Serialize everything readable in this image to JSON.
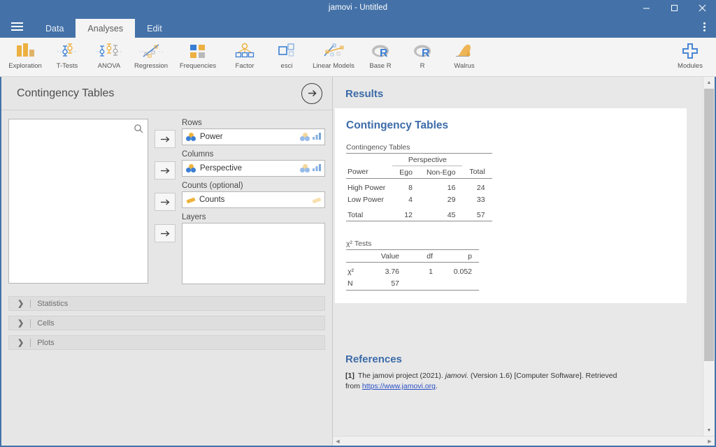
{
  "window": {
    "title": "jamovi - Untitled",
    "minimize_label": "minimize-icon",
    "maximize_label": "maximize-icon",
    "close_label": "close-icon",
    "accent": "#4472a8"
  },
  "tabs": [
    {
      "label": "Data",
      "active": false
    },
    {
      "label": "Analyses",
      "active": true
    },
    {
      "label": "Edit",
      "active": false
    }
  ],
  "ribbon": {
    "items": [
      {
        "label": "Exploration",
        "icon": "bar-chart-icon"
      },
      {
        "label": "T-Tests",
        "icon": "error-bars-icon"
      },
      {
        "label": "ANOVA",
        "icon": "error-bars-triple-icon"
      },
      {
        "label": "Regression",
        "icon": "scatter-line-icon"
      },
      {
        "label": "Frequencies",
        "icon": "four-squares-icon"
      },
      {
        "label": "Factor",
        "icon": "factor-tree-icon"
      },
      {
        "label": "esci",
        "icon": "squares-icon"
      },
      {
        "label": "Linear Models",
        "icon": "linear-models-icon"
      },
      {
        "label": "Base R",
        "icon": "r-logo-icon"
      },
      {
        "label": "R",
        "icon": "r-logo-icon"
      },
      {
        "label": "Walrus",
        "icon": "walrus-icon"
      }
    ],
    "modules": {
      "label": "Modules",
      "icon": "plus-icon"
    }
  },
  "options": {
    "title": "Contingency Tables",
    "collapse_icon": "arrow-right-circle-icon",
    "search_icon": "search-icon",
    "variable_pool": {
      "items": []
    },
    "assign_icon": "arrow-right-icon",
    "groups": [
      {
        "label": "Rows",
        "name": "rows",
        "kind": "single",
        "variable": "Power",
        "measure_icon": "nominal-icon",
        "type_icons": [
          "nominal-icon",
          "bars-icon"
        ]
      },
      {
        "label": "Columns",
        "name": "columns",
        "kind": "single",
        "variable": "Perspective",
        "measure_icon": "nominal-icon",
        "type_icons": [
          "nominal-icon",
          "bars-icon"
        ]
      },
      {
        "label": "Counts (optional)",
        "name": "counts",
        "kind": "single",
        "variable": "Counts",
        "measure_icon": "continuous-icon",
        "type_icons": [
          "continuous-icon"
        ]
      },
      {
        "label": "Layers",
        "name": "layers",
        "kind": "box",
        "variable": "",
        "measure_icon": "",
        "type_icons": []
      }
    ],
    "sections": [
      {
        "label": "Statistics",
        "expanded": false,
        "chevron": "chevron-right-icon"
      },
      {
        "label": "Cells",
        "expanded": false,
        "chevron": "chevron-right-icon"
      },
      {
        "label": "Plots",
        "expanded": false,
        "chevron": "chevron-right-icon"
      }
    ]
  },
  "results": {
    "heading": "Results",
    "analysis_title": "Contingency Tables",
    "contingency": {
      "caption": "Contingency Tables",
      "group_header": "Perspective",
      "row_header": "Power",
      "col_headers": [
        "Ego",
        "Non-Ego",
        "Total"
      ],
      "rows": [
        {
          "label": "High Power",
          "values": [
            "8",
            "16",
            "24"
          ]
        },
        {
          "label": "Low Power",
          "values": [
            "4",
            "29",
            "33"
          ]
        },
        {
          "label": "Total",
          "values": [
            "12",
            "45",
            "57"
          ]
        }
      ]
    },
    "chisq": {
      "caption": "χ² Tests",
      "col_headers": [
        "Value",
        "df",
        "p"
      ],
      "rows": [
        {
          "label": "χ²",
          "values": [
            "3.76",
            "1",
            "0.052"
          ]
        },
        {
          "label": "N",
          "values": [
            "57",
            "",
            ""
          ]
        }
      ]
    },
    "references": {
      "heading": "References",
      "entries": [
        {
          "num": "[1]",
          "pre": "The jamovi project (2021). ",
          "italic": "jamovi.",
          "mid": " (Version 1.6) [Computer Software]. Retrieved from ",
          "link": "https://www.jamovi.org",
          "post": "."
        }
      ]
    }
  },
  "scrollbars": {
    "vertical_up": "scroll-up-icon",
    "vertical_down": "scroll-down-icon",
    "horizontal_left": "scroll-left-icon",
    "horizontal_right": "scroll-right-icon"
  }
}
